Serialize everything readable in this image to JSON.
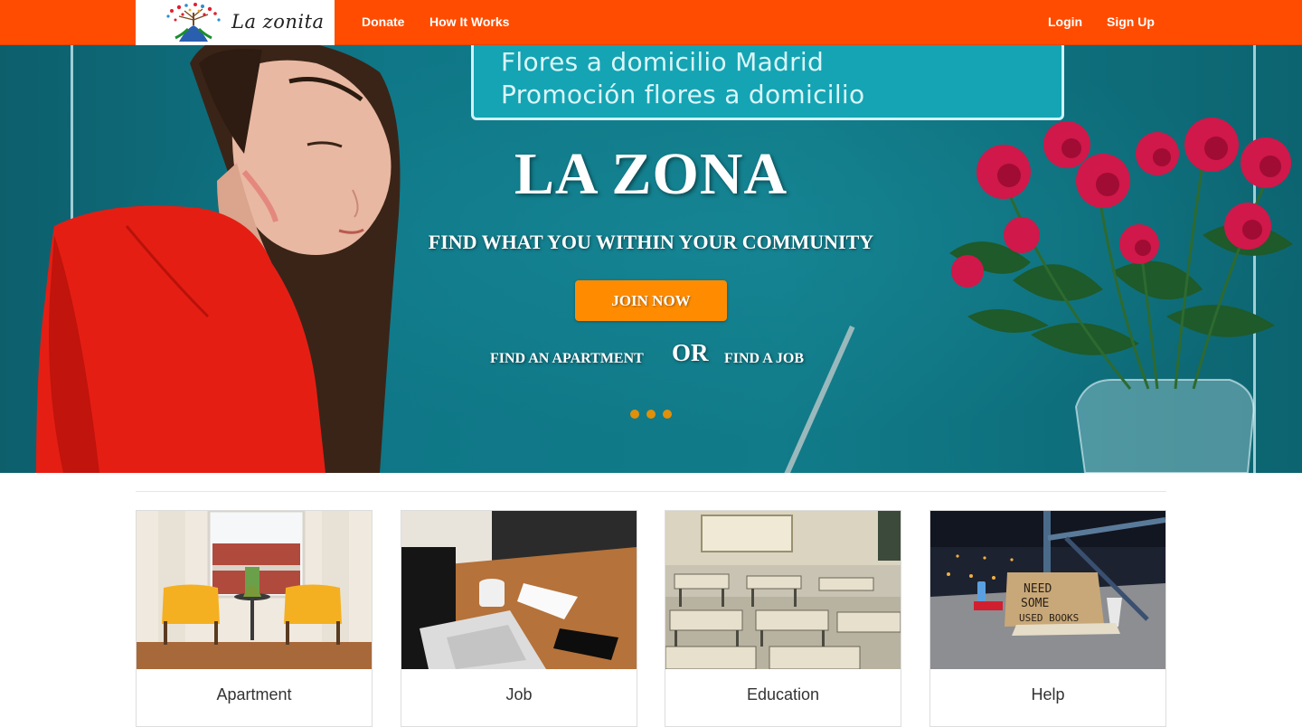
{
  "navbar": {
    "logo_text": "La zonita",
    "links": {
      "donate": "Donate",
      "how_it_works": "How It Works",
      "login": "Login",
      "signup": "Sign Up"
    },
    "bg_color": "#ff4c00"
  },
  "hero": {
    "sign_line_1": "Flores a domicilio Madrid",
    "sign_line_2": "Promoción flores a domicilio",
    "title": "LA ZONA",
    "subtitle": "FIND WHAT YOU WITHIN YOUR COMMUNITY",
    "join_button": "JOIN NOW",
    "find_apartment": "FIND AN APARTMENT",
    "or_text": "OR",
    "find_job": "FIND A JOB",
    "carousel_dots": 3,
    "accent_color": "#ff8c00"
  },
  "categories": [
    {
      "label": "Apartment",
      "image": "apartment-photo"
    },
    {
      "label": "Job",
      "image": "laptop-desk-photo"
    },
    {
      "label": "Education",
      "image": "classroom-photo"
    },
    {
      "label": "Help",
      "image": "help-sign-photo"
    }
  ]
}
